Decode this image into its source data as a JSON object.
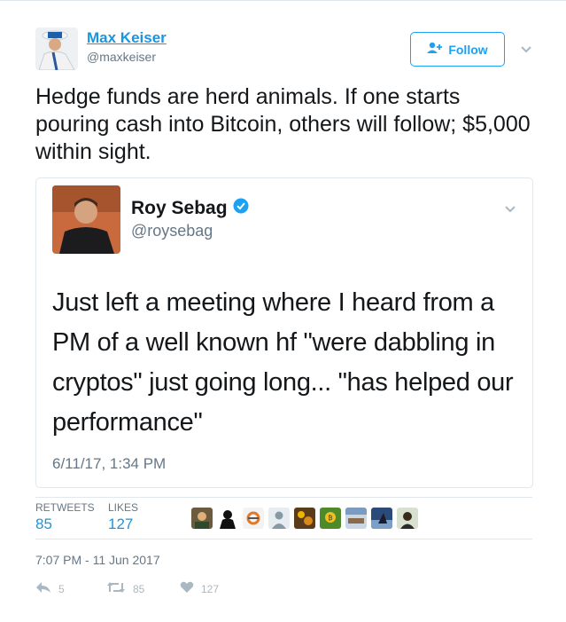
{
  "author": {
    "name": "Max Keiser",
    "handle": "@maxkeiser"
  },
  "follow_button": {
    "label": "Follow",
    "icon": "follow-user-icon"
  },
  "tweet": {
    "text": "Hedge funds are herd animals. If one starts pouring cash into Bitcoin, others will follow; $5,000 within sight.",
    "timestamp": "7:07 PM - 11 Jun 2017"
  },
  "quoted_tweet": {
    "name": "Roy Sebag",
    "verified_icon": "verified-badge-icon",
    "handle": "@roysebag",
    "text": "Just left a meeting where I heard from a PM of a well known hf \"were dabbling in cryptos\" just going long... \"has helped our performance\"",
    "time": "6/11/17, 1:34 PM"
  },
  "stats": {
    "retweets_label": "RETWEETS",
    "retweets_value": "85",
    "likes_label": "LIKES",
    "likes_value": "127"
  },
  "actions": {
    "reply_count": "5",
    "retweet_count": "85",
    "like_count": "127"
  },
  "colors": {
    "link_blue": "#1b95e0",
    "follow_blue": "#1da1f2",
    "muted_gray": "#657786",
    "icon_gray": "#aab8c2",
    "border": "#e1e8ed"
  }
}
